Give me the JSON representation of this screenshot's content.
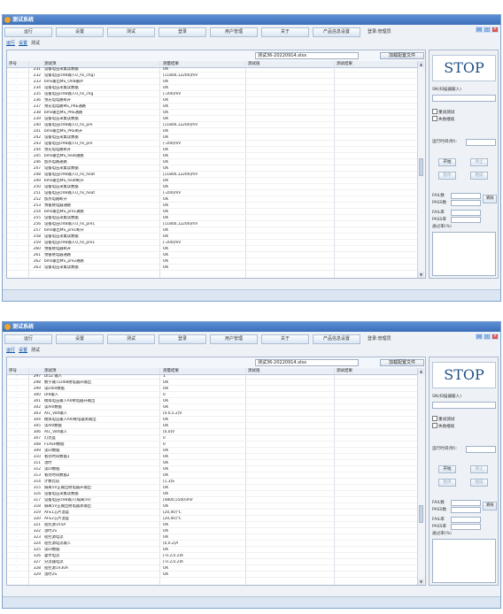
{
  "app": {
    "title": "测试系统",
    "menu": [
      "运行",
      "设置",
      "测试",
      "登录",
      "用户管理",
      "关于",
      "产品信息设置"
    ],
    "login_status": "登录:管理员",
    "tabs": [
      {
        "label": "运行"
      },
      {
        "label": "设置"
      },
      {
        "label": "测试"
      }
    ],
    "file_name": "测试36-20220914.xlsx",
    "load_button": "加载配置文件",
    "columns": [
      "序号",
      "测试项",
      "测量结果",
      "测试值",
      "测试结果"
    ]
  },
  "side_panel": {
    "stop": "STOP",
    "sn_label": "SN(扫描器输入)",
    "check_retest": "重试测试",
    "check_stop_on_fail": "失败继续",
    "elapsed_label": "运行时间(秒):",
    "start": "开始",
    "stop_btn": "停止",
    "pause": "暂停",
    "resume": "继续",
    "fail_count_label": "FAIL数",
    "pass_count_label": "PASS数",
    "clear": "清除",
    "fail_rate_label": "FAIL率",
    "pass_rate_label": "PASS率",
    "pass_percent_label": "通过率(%)"
  },
  "window1_rows": [
    {
      "no": "231",
      "name": "设备电压采集读数据",
      "val": "OK"
    },
    {
      "no": "232",
      "name": "设备电压OVB输入U_hs_chg)",
      "val": "[11800,12200]mV"
    },
    {
      "no": "233",
      "name": "bms输出MS_OVB循环",
      "val": "OK"
    },
    {
      "no": "234",
      "name": "设备电压采集读数据",
      "val": "OK"
    },
    {
      "no": "235",
      "name": "设备电压OVB输入U_hs_chg",
      "val": "[-200]mV"
    },
    {
      "no": "236",
      "name": "预充电电路断开",
      "val": "OK"
    },
    {
      "no": "237",
      "name": "预充电电路MS_PRE通路",
      "val": "OK"
    },
    {
      "no": "238",
      "name": "bms输出MS_PRE通路",
      "val": "OK"
    },
    {
      "no": "239",
      "name": "设备电压采集读数据",
      "val": "OK"
    },
    {
      "no": "240",
      "name": "设备电压OVB输入U_hs_pre",
      "val": "[11800,12200]mV"
    },
    {
      "no": "241",
      "name": "bms输出MS_PRE断开",
      "val": "OK"
    },
    {
      "no": "242",
      "name": "设备电压采集读数据",
      "val": "OK"
    },
    {
      "no": "243",
      "name": "设备电压OVB输入U_hs_pre",
      "val": "[-200]mV"
    },
    {
      "no": "244",
      "name": "预充电电路断开",
      "val": "OK"
    },
    {
      "no": "245",
      "name": "bms输出MS_heat通路",
      "val": "OK"
    },
    {
      "no": "246",
      "name": "加热电路通路",
      "val": "OK"
    },
    {
      "no": "247",
      "name": "设备电压采集读数据",
      "val": "OK"
    },
    {
      "no": "248",
      "name": "设备电压OVB输入U_hs_heat",
      "val": "[11800,12200]mV"
    },
    {
      "no": "249",
      "name": "bms输出MS_heat断开",
      "val": "OK"
    },
    {
      "no": "250",
      "name": "设备电压采集读数据",
      "val": "OK"
    },
    {
      "no": "251",
      "name": "设备电压OVB输入U_hs_heat",
      "val": "[-200]mV"
    },
    {
      "no": "252",
      "name": "加热电路断开",
      "val": "OK"
    },
    {
      "no": "253",
      "name": "预备继电器通路",
      "val": "OK"
    },
    {
      "no": "254",
      "name": "bms输出MS_pre1通路",
      "val": "OK"
    },
    {
      "no": "255",
      "name": "设备电压采集读数据",
      "val": "OK"
    },
    {
      "no": "256",
      "name": "设备电压OVB输入U_hs_pre1",
      "val": "[11800,12200]mV"
    },
    {
      "no": "257",
      "name": "bms输出MS_pre1断开",
      "val": "OK"
    },
    {
      "no": "258",
      "name": "设备电压采集读数据",
      "val": "OK"
    },
    {
      "no": "259",
      "name": "设备电压OVB输入U_hs_pre1",
      "val": "[-200]mV"
    },
    {
      "no": "260",
      "name": "预备继电器断开",
      "val": "OK"
    },
    {
      "no": "261",
      "name": "预备继电器通路",
      "val": "OK"
    },
    {
      "no": "262",
      "name": "bms输出MS_pre2通路",
      "val": "OK"
    },
    {
      "no": "263",
      "name": "设备电压采集读数据",
      "val": "OK"
    }
  ],
  "window2_rows": [
    {
      "no": "297",
      "name": "DI12 输入",
      "val": "1"
    },
    {
      "no": "298",
      "name": "数字输入DI08继电器开输出",
      "val": "OK"
    },
    {
      "no": "299",
      "name": "读DI04数据",
      "val": "OK"
    },
    {
      "no": "300",
      "name": "DI0输入",
      "val": "0"
    },
    {
      "no": "301",
      "name": "模拟电压输入A0继电器开输出",
      "val": "OK"
    },
    {
      "no": "302",
      "name": "读AI0数据",
      "val": "OK"
    },
    {
      "no": "303",
      "name": "AI1_Volt输入",
      "val": "[4.0,5.2]V"
    },
    {
      "no": "304",
      "name": "模拟电压输入AI0继电器关输出",
      "val": "OK"
    },
    {
      "no": "305",
      "name": "读AI0数据",
      "val": "OK"
    },
    {
      "no": "306",
      "name": "AI1_Volt输入",
      "val": "[0,0]V"
    },
    {
      "no": "307",
      "name": "灯亮度",
      "val": "0"
    },
    {
      "no": "308",
      "name": "FLASH数据",
      "val": "0"
    },
    {
      "no": "309",
      "name": "读DI数据",
      "val": "OK"
    },
    {
      "no": "310",
      "name": "看到时间数据1",
      "val": "OK"
    },
    {
      "no": "311",
      "name": "温时",
      "val": "OK"
    },
    {
      "no": "312",
      "name": "读DI数据",
      "val": "OK"
    },
    {
      "no": "313",
      "name": "看到时间数据2",
      "val": "OK"
    },
    {
      "no": "314",
      "name": "计数比较",
      "val": "[1,3]S"
    },
    {
      "no": "315",
      "name": "隔离5V正输出继电器开输出",
      "val": "OK"
    },
    {
      "no": "316",
      "name": "设备电压采集读数据",
      "val": "OK"
    },
    {
      "no": "317",
      "name": "设备电压OVB输入(隔离5V)",
      "val": "[4800,5500]mV"
    },
    {
      "no": "318",
      "name": "隔离5V正输出继电器关输出",
      "val": "OK"
    },
    {
      "no": "319",
      "name": "AFE1芯片温度",
      "val": "[20,40]°C"
    },
    {
      "no": "320",
      "name": "AFE2芯片温度",
      "val": "[20,40]°C"
    },
    {
      "no": "321",
      "name": "程控源1V5A",
      "val": "OK"
    },
    {
      "no": "322",
      "name": "温时2S",
      "val": "OK"
    },
    {
      "no": "323",
      "name": "程控源电流",
      "val": "OK"
    },
    {
      "no": "324",
      "name": "程控源电流输入",
      "val": "[0,0.2]A"
    },
    {
      "no": "325",
      "name": "读DI数据",
      "val": "OK"
    },
    {
      "no": "326",
      "name": "霍尔电流",
      "val": "[-0.2,0.2]A"
    },
    {
      "no": "327",
      "name": "分流器电流",
      "val": "[-0.2,0.2]A"
    },
    {
      "no": "328",
      "name": "程控源1V30A",
      "val": "OK"
    },
    {
      "no": "329",
      "name": "温时2S",
      "val": "OK"
    }
  ]
}
